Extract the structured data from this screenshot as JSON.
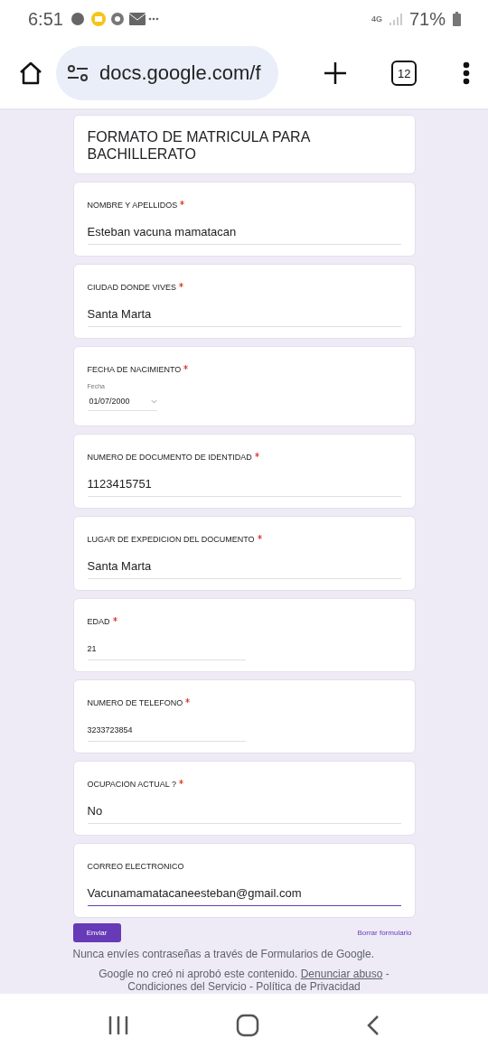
{
  "status_bar": {
    "time": "6:51",
    "network": "4G",
    "battery": "71%"
  },
  "browser": {
    "url": "docs.google.com/f",
    "tab_count": "12"
  },
  "form": {
    "title": "FORMATO DE MATRICULA PARA BACHILLERATO",
    "questions": [
      {
        "kind": "text",
        "label": "NOMBRE Y APELLIDOS",
        "required": true,
        "value": "Esteban vacuna mamatacan",
        "focused": false
      },
      {
        "kind": "text",
        "label": "CIUDAD DONDE VIVES",
        "required": true,
        "value": "Santa Marta",
        "focused": false
      },
      {
        "kind": "date",
        "label": "FECHA DE NACIMIENTO",
        "required": true,
        "sublabel": "Fecha",
        "value": "01/07/2000",
        "focused": false
      },
      {
        "kind": "text",
        "label": "NUMERO DE DOCUMENTO DE IDENTIDAD",
        "required": true,
        "value": "1123415751",
        "focused": false
      },
      {
        "kind": "text",
        "label": "LUGAR DE EXPEDICION DEL DOCUMENTO",
        "required": true,
        "value": "Santa Marta",
        "focused": false
      },
      {
        "kind": "short",
        "label": "EDAD",
        "required": true,
        "value": "21",
        "focused": false
      },
      {
        "kind": "short",
        "label": "NUMERO DE TELEFONO",
        "required": true,
        "value": "3233723854",
        "focused": false
      },
      {
        "kind": "text",
        "label": "OCUPACION ACTUAL ?",
        "required": true,
        "value": "No",
        "focused": false
      },
      {
        "kind": "text",
        "label": "CORREO ELECTRONICO",
        "required": false,
        "value": "Vacunamamatacaneesteban@gmail.com",
        "focused": true
      }
    ],
    "submit": "Enviar",
    "clear": "Borrar formulario",
    "warning": "Nunca envíes contraseñas a través de Formularios de Google.",
    "disclaimer": "Google no creó ni aprobó este contenido.",
    "report_link": "Denunciar abuso",
    "separator": "-",
    "footer_links": "Condiciones del Servicio - Política de Privacidad"
  }
}
